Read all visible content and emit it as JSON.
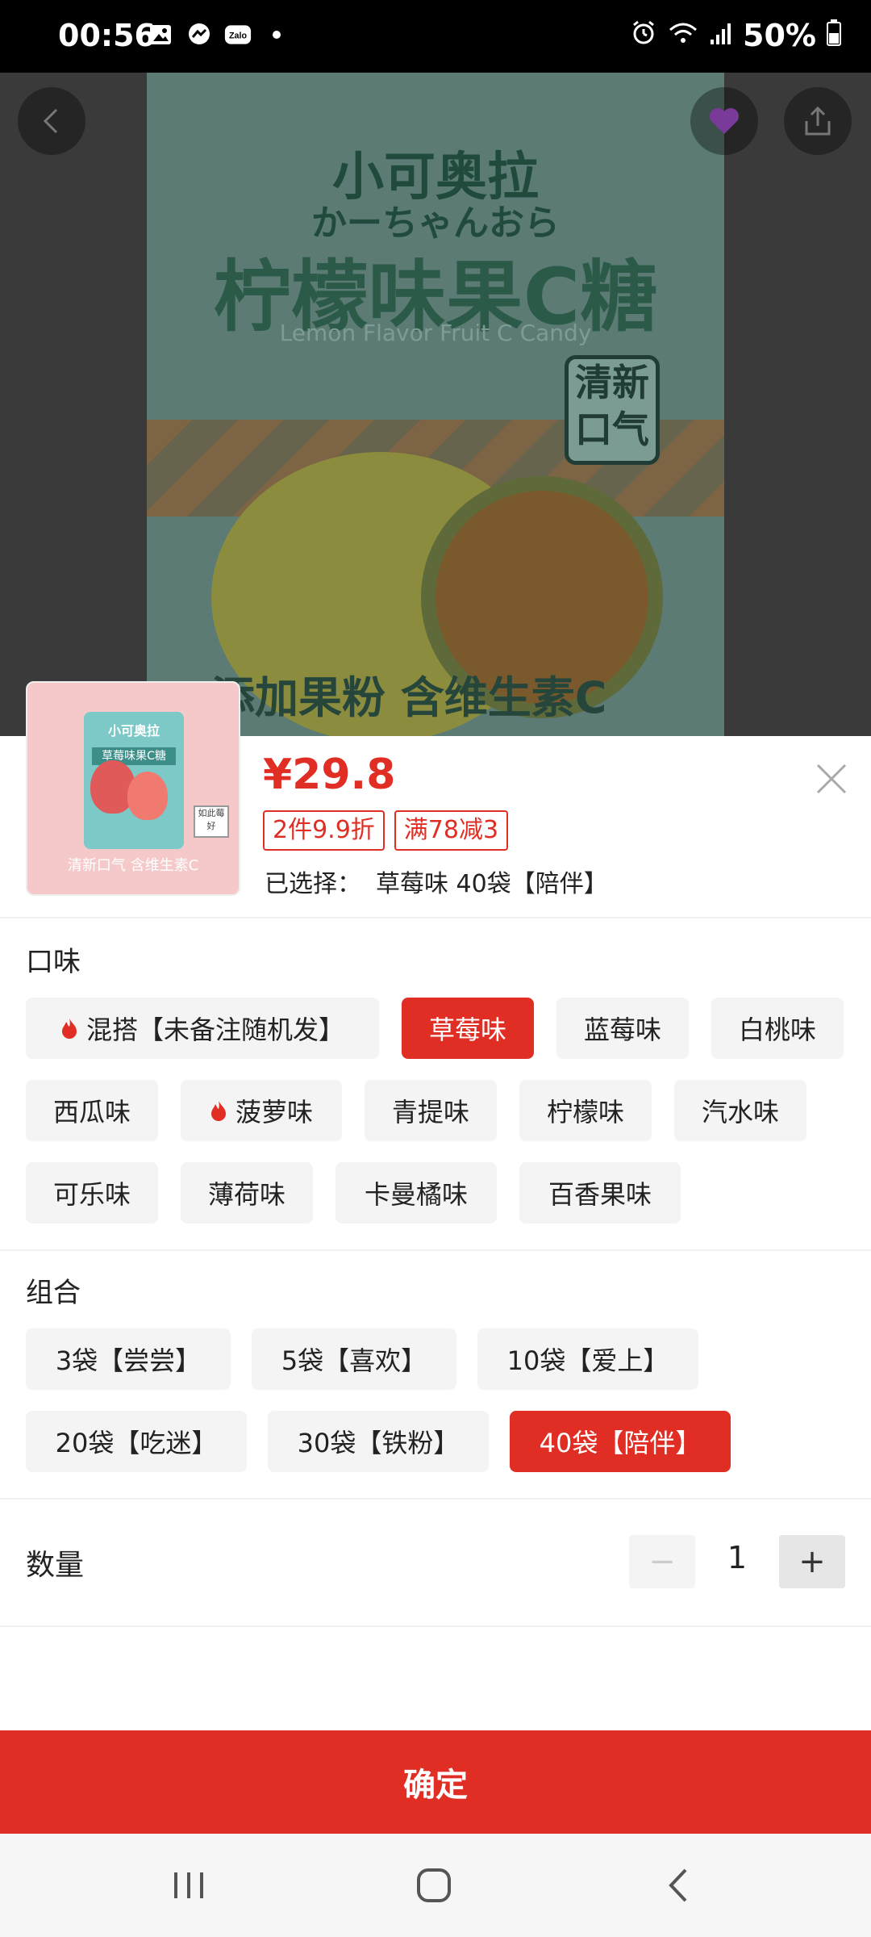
{
  "status_bar": {
    "time": "00:56",
    "battery": "50%",
    "left_icons": [
      "gallery-icon",
      "messenger-icon",
      "zalo-icon",
      "dot-icon"
    ],
    "right_icons": [
      "alarm-icon",
      "wifi-icon",
      "signal-icon",
      "battery-icon"
    ]
  },
  "hero": {
    "brand_cn": "小可奥拉",
    "brand_jp": "かーちゃんおら",
    "product_name": "柠檬味果C糖",
    "product_en": "Lemon Flavor Fruit C Candy",
    "badge_text": "清新口气",
    "stamp_text": "添加果粉 含维生素C"
  },
  "product": {
    "price": "¥29.8",
    "promos": [
      "2件9.9折",
      "满78减3"
    ],
    "selected_label": "已选择：",
    "selected_value": "草莓味 40袋【陪伴】",
    "thumb": {
      "bag_title": "小可奥拉",
      "bag_label": "草莓味果C糖",
      "tag": "如此莓好",
      "caption": "清新口气 含维生素C"
    }
  },
  "flavor": {
    "title": "口味",
    "options": [
      {
        "label": "混搭【未备注随机发】",
        "hot": true,
        "selected": false
      },
      {
        "label": "草莓味",
        "hot": false,
        "selected": true
      },
      {
        "label": "蓝莓味",
        "hot": false,
        "selected": false
      },
      {
        "label": "白桃味",
        "hot": false,
        "selected": false
      },
      {
        "label": "西瓜味",
        "hot": false,
        "selected": false
      },
      {
        "label": "菠萝味",
        "hot": true,
        "selected": false
      },
      {
        "label": "青提味",
        "hot": false,
        "selected": false
      },
      {
        "label": "柠檬味",
        "hot": false,
        "selected": false
      },
      {
        "label": "汽水味",
        "hot": false,
        "selected": false
      },
      {
        "label": "可乐味",
        "hot": false,
        "selected": false
      },
      {
        "label": "薄荷味",
        "hot": false,
        "selected": false
      },
      {
        "label": "卡曼橘味",
        "hot": false,
        "selected": false
      },
      {
        "label": "百香果味",
        "hot": false,
        "selected": false
      }
    ]
  },
  "combo": {
    "title": "组合",
    "options": [
      {
        "label": "3袋【尝尝】",
        "selected": false
      },
      {
        "label": "5袋【喜欢】",
        "selected": false
      },
      {
        "label": "10袋【爱上】",
        "selected": false
      },
      {
        "label": "20袋【吃迷】",
        "selected": false
      },
      {
        "label": "30袋【铁粉】",
        "selected": false
      },
      {
        "label": "40袋【陪伴】",
        "selected": true
      }
    ]
  },
  "quantity": {
    "label": "数量",
    "value": "1",
    "minus": "−",
    "plus": "+"
  },
  "confirm_label": "确定",
  "colors": {
    "accent": "#e02e24",
    "chip_bg": "#f4f4f4"
  }
}
